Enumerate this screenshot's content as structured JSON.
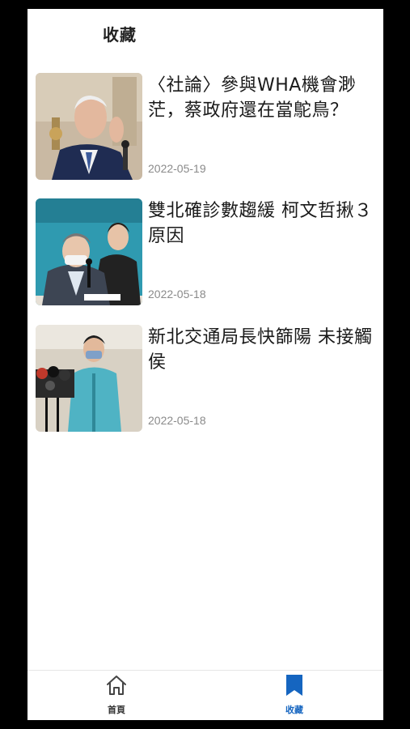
{
  "header": {
    "title": "收藏"
  },
  "articles": [
    {
      "title": "〈社論〉參與WHA機會渺茫，蔡政府還在當鴕鳥？",
      "date": "2022-05-19"
    },
    {
      "title": "雙北確診數趨緩 柯文哲揪３原因",
      "date": "2022-05-18"
    },
    {
      "title": "新北交通局長快篩陽 未接觸侯",
      "date": "2022-05-18"
    }
  ],
  "bottom_nav": {
    "items": [
      {
        "label": "首頁",
        "icon": "home-icon",
        "active": false
      },
      {
        "label": "收藏",
        "icon": "bookmark-icon",
        "active": true
      }
    ]
  },
  "colors": {
    "accent": "#1565c0",
    "date": "#8a8a8a"
  }
}
